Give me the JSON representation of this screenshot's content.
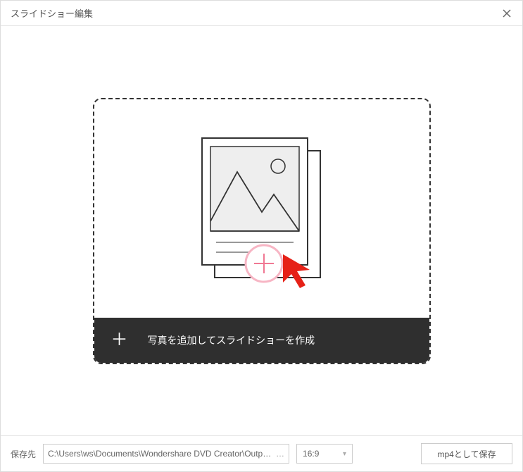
{
  "titlebar": {
    "title": "スライドショー編集"
  },
  "dropzone": {
    "bar_label": "写真を追加してスライドショーを作成"
  },
  "footer": {
    "save_label": "保存先",
    "save_path": "C:\\Users\\ws\\Documents\\Wondershare DVD Creator\\Output\\",
    "aspect_ratio": "16:9",
    "save_button": "mp4として保存"
  },
  "colors": {
    "accent_pink": "#f07893",
    "arrow_red": "#e62117"
  }
}
